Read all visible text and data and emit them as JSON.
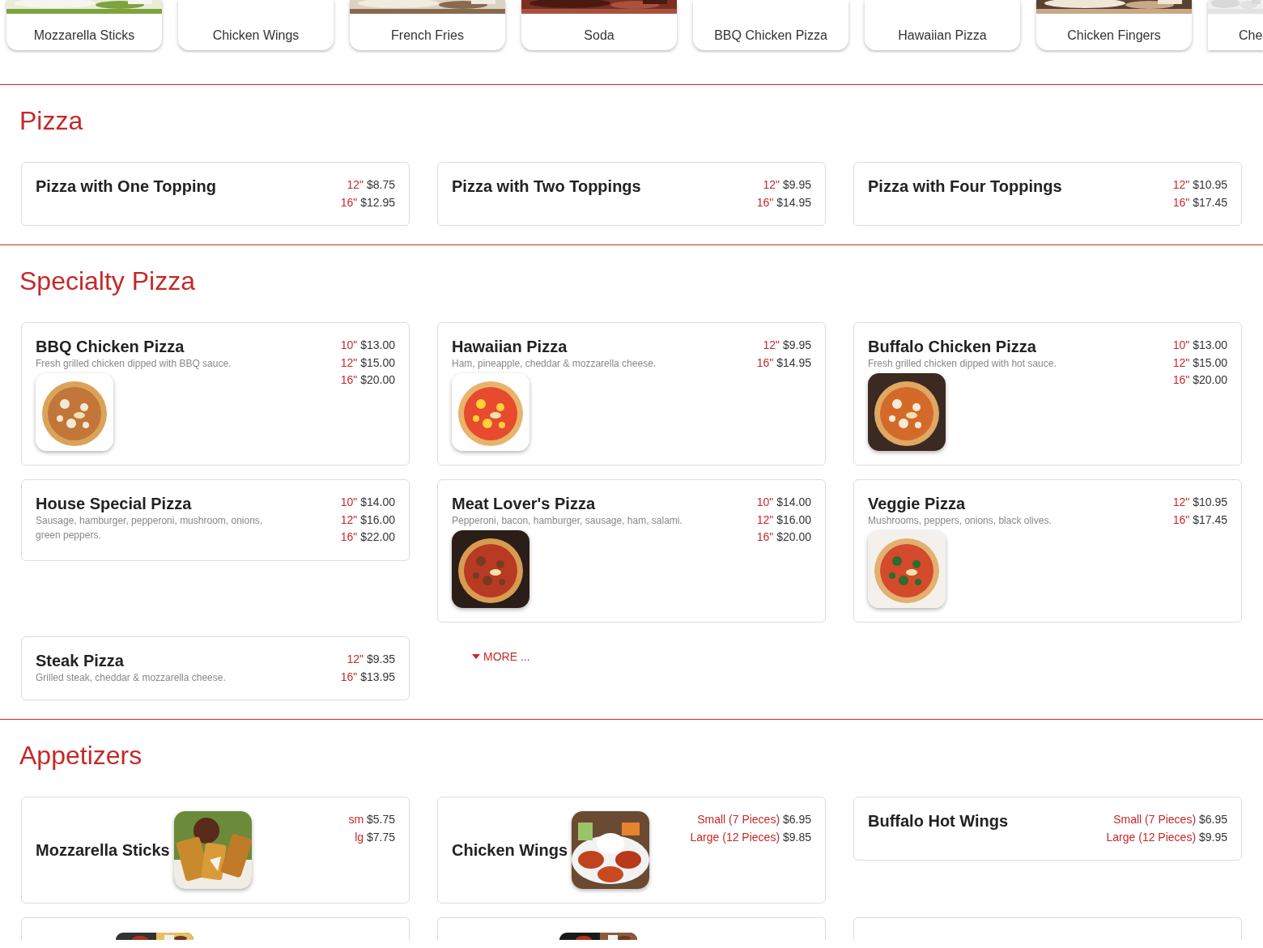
{
  "category_strip": [
    {
      "label": "Mozzarella Sticks",
      "has_picture": true,
      "cut_off": false
    },
    {
      "label": "Chicken Wings",
      "has_picture": false,
      "cut_off": false
    },
    {
      "label": "French Fries",
      "has_picture": true,
      "cut_off": false
    },
    {
      "label": "Soda",
      "has_picture": true,
      "cut_off": false
    },
    {
      "label": "BBQ Chicken Pizza",
      "has_picture": false,
      "cut_off": false
    },
    {
      "label": "Hawaiian Pizza",
      "has_picture": false,
      "cut_off": false
    },
    {
      "label": "Chicken Fingers",
      "has_picture": true,
      "cut_off": false
    },
    {
      "label": "Che",
      "has_picture": true,
      "cut_off": true
    }
  ],
  "sections": [
    {
      "title": "Pizza",
      "items": [
        {
          "kind": "stacked",
          "name": "Pizza with One Topping",
          "has_picture": false,
          "prices": [
            {
              "size": "12\"",
              "price": "$8.75"
            },
            {
              "size": "16\"",
              "price": "$12.95"
            }
          ]
        },
        {
          "kind": "stacked",
          "name": "Pizza with Two Toppings",
          "has_picture": false,
          "prices": [
            {
              "size": "12\"",
              "price": "$9.95"
            },
            {
              "size": "16\"",
              "price": "$14.95"
            }
          ]
        },
        {
          "kind": "stacked",
          "name": "Pizza with Four Toppings",
          "has_picture": false,
          "prices": [
            {
              "size": "12\"",
              "price": "$10.95"
            },
            {
              "size": "16\"",
              "price": "$17.45"
            }
          ]
        }
      ]
    },
    {
      "title": "Specialty Pizza",
      "items": [
        {
          "kind": "stacked",
          "name": "BBQ Chicken Pizza",
          "description": "Fresh grilled chicken dipped with BBQ sauce.",
          "has_picture": true,
          "prices": [
            {
              "size": "10\"",
              "price": "$13.00"
            },
            {
              "size": "12\"",
              "price": "$15.00"
            },
            {
              "size": "16\"",
              "price": "$20.00"
            }
          ]
        },
        {
          "kind": "stacked",
          "name": "Hawaiian Pizza",
          "description": "Ham, pineapple, cheddar & mozzarella cheese.",
          "has_picture": true,
          "prices": [
            {
              "size": "12\"",
              "price": "$9.95"
            },
            {
              "size": "16\"",
              "price": "$14.95"
            }
          ]
        },
        {
          "kind": "stacked",
          "name": "Buffalo Chicken Pizza",
          "description": "Fresh grilled chicken dipped with hot sauce.",
          "has_picture": true,
          "prices": [
            {
              "size": "10\"",
              "price": "$13.00"
            },
            {
              "size": "12\"",
              "price": "$15.00"
            },
            {
              "size": "16\"",
              "price": "$20.00"
            }
          ]
        },
        {
          "kind": "stacked",
          "name": "House Special Pizza",
          "description": "Sausage, hamburger, pepperoni, mushroom, onions, green peppers.",
          "has_picture": false,
          "prices": [
            {
              "size": "10\"",
              "price": "$14.00"
            },
            {
              "size": "12\"",
              "price": "$16.00"
            },
            {
              "size": "16\"",
              "price": "$22.00"
            }
          ]
        },
        {
          "kind": "stacked",
          "name": "Meat Lover's Pizza",
          "description": "Pepperoni, bacon, hamburger, sausage, ham, salami.",
          "has_picture": true,
          "prices": [
            {
              "size": "10\"",
              "price": "$14.00"
            },
            {
              "size": "12\"",
              "price": "$16.00"
            },
            {
              "size": "16\"",
              "price": "$20.00"
            }
          ]
        },
        {
          "kind": "stacked",
          "name": "Veggie Pizza",
          "description": "Mushrooms, peppers, onions, black olives.",
          "has_picture": true,
          "prices": [
            {
              "size": "12\"",
              "price": "$10.95"
            },
            {
              "size": "16\"",
              "price": "$17.45"
            }
          ]
        },
        {
          "kind": "stacked",
          "name": "Steak Pizza",
          "description": "Grilled steak, cheddar & mozzarella cheese.",
          "has_picture": false,
          "prices": [
            {
              "size": "12\"",
              "price": "$9.35"
            },
            {
              "size": "16\"",
              "price": "$13.95"
            }
          ]
        }
      ],
      "more_link": "MORE ..."
    },
    {
      "title": "Appetizers",
      "items": [
        {
          "kind": "inline",
          "name": "Mozzarella Sticks",
          "has_picture": true,
          "prices": [
            {
              "size": "sm",
              "price": "$5.75"
            },
            {
              "size": "lg",
              "price": "$7.75"
            }
          ]
        },
        {
          "kind": "inline",
          "name": "Chicken Wings",
          "has_picture": true,
          "prices": [
            {
              "size": "Small (7 Pieces)",
              "price": "$6.95"
            },
            {
              "size": "Large (12 Pieces)",
              "price": "$9.85"
            }
          ]
        },
        {
          "kind": "inline",
          "name": "Buffalo Hot Wings",
          "has_picture": false,
          "prices": [
            {
              "size": "Small (7 Pieces)",
              "price": "$6.95"
            },
            {
              "size": "Large (12 Pieces)",
              "price": "$9.95"
            }
          ]
        }
      ],
      "cut_cards": [
        {
          "has_picture": true
        },
        {
          "has_picture": true
        },
        {
          "has_picture": false
        }
      ]
    }
  ]
}
